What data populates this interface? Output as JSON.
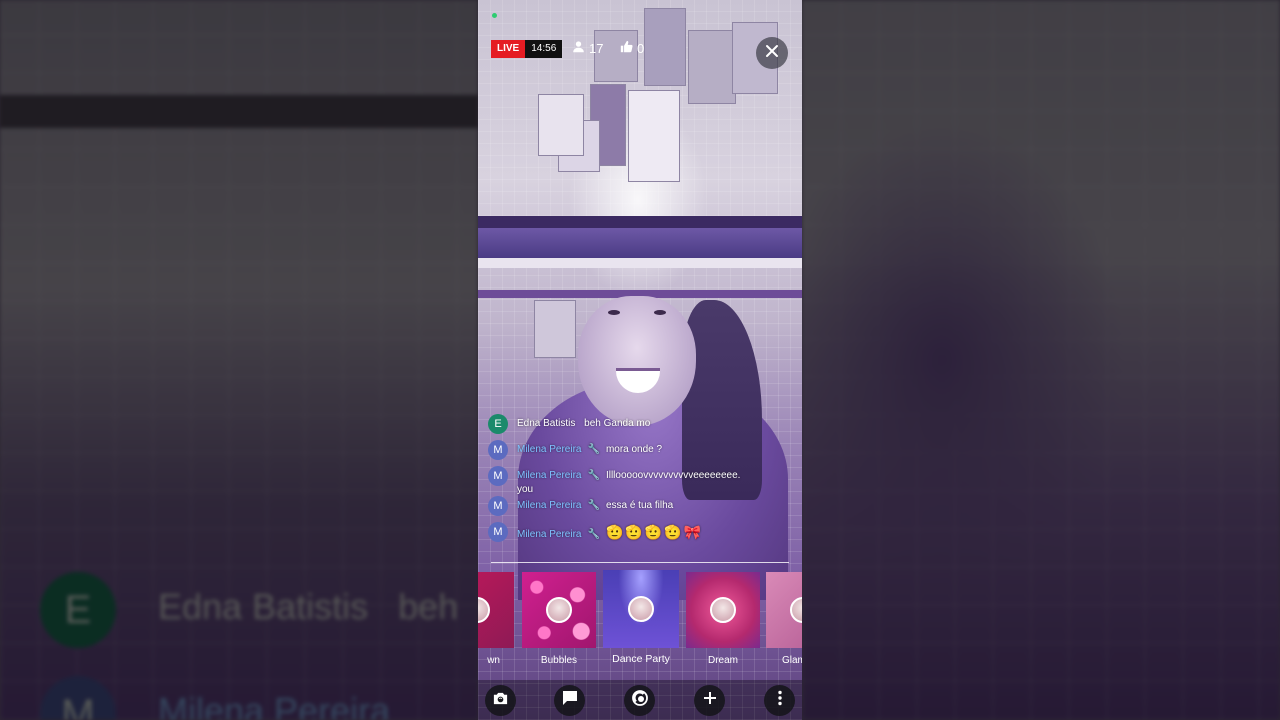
{
  "stream": {
    "live_label": "LIVE",
    "elapsed": "14:56",
    "viewers": "17",
    "likes": "0"
  },
  "background_overlay": {
    "name_1": "Edna Batistis",
    "fragment_1": "beh",
    "initial_1": "E",
    "name_2": "Milena Pereira",
    "initial_2": "M"
  },
  "chat": {
    "messages": [
      {
        "initial": "E",
        "name": "Edna Batistis",
        "moderator": false,
        "text": "beh Ganda mo"
      },
      {
        "initial": "M",
        "name": "Milena Pereira",
        "moderator": true,
        "text": "mora onde ?"
      },
      {
        "initial": "M",
        "name": "Milena Pereira",
        "moderator": true,
        "text": "Illlooooovvvvvvvvvveeeeeeee.",
        "text2": "you"
      },
      {
        "initial": "M",
        "name": "Milena Pereira",
        "moderator": true,
        "text": "essa é tua filha"
      },
      {
        "initial": "M",
        "name": "Milena Pereira",
        "moderator": true,
        "text": "🫡🫡🫡🫡🎀"
      }
    ]
  },
  "filters": {
    "items": [
      {
        "label": "wn"
      },
      {
        "label": "Bubbles"
      },
      {
        "label": "Dance Party",
        "selected": true
      },
      {
        "label": "Dream"
      },
      {
        "label": "Glam"
      }
    ]
  },
  "toolbar": {
    "items": [
      "camera-flip",
      "chat",
      "filters",
      "add",
      "more"
    ]
  },
  "colors": {
    "live_red": "#e51c23",
    "moderator_name": "#7ec3ff",
    "avatar_e": "#1b8a6b",
    "avatar_m": "#5c6bc0"
  }
}
